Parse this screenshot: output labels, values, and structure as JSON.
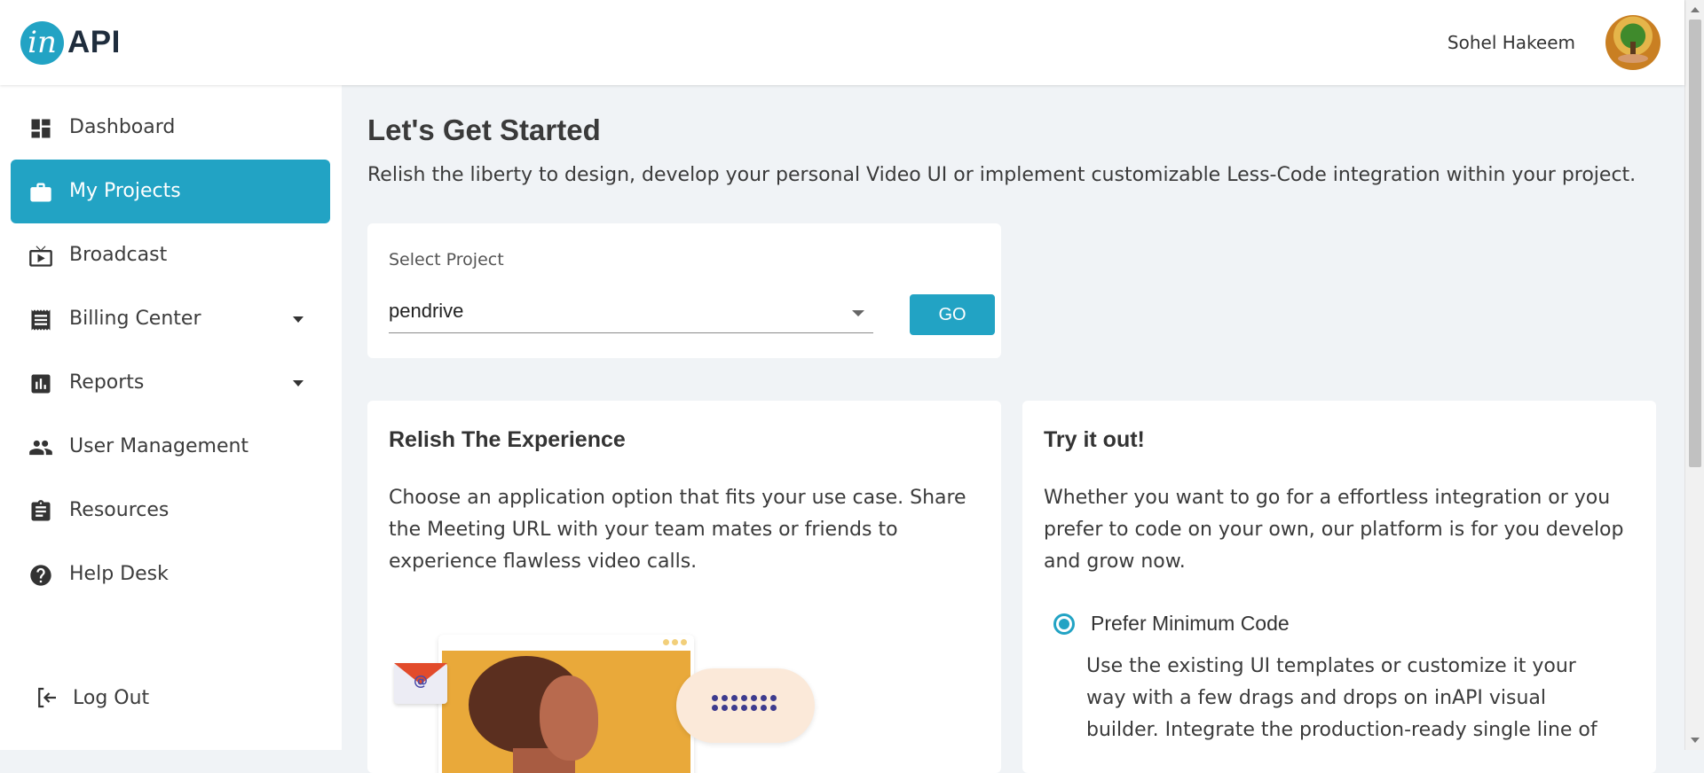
{
  "header": {
    "logo_letter": "in",
    "logo_text": "API",
    "user_name": "Sohel Hakeem"
  },
  "sidebar": {
    "items": [
      {
        "label": "Dashboard",
        "icon": "dashboard-icon"
      },
      {
        "label": "My Projects",
        "icon": "briefcase-icon",
        "active": true
      },
      {
        "label": "Broadcast",
        "icon": "tv-icon"
      },
      {
        "label": "Billing Center",
        "icon": "receipt-icon",
        "expandable": true
      },
      {
        "label": "Reports",
        "icon": "bar-chart-icon",
        "expandable": true
      },
      {
        "label": "User Management",
        "icon": "users-icon"
      },
      {
        "label": "Resources",
        "icon": "clipboard-icon"
      },
      {
        "label": "Help Desk",
        "icon": "help-icon"
      }
    ],
    "logout_label": "Log Out"
  },
  "main": {
    "title": "Let's Get Started",
    "subtitle": "Relish the liberty to design, develop your personal Video UI or implement customizable Less-Code integration within your project.",
    "select_project": {
      "label": "Select Project",
      "value": "pendrive",
      "go_label": "GO"
    },
    "experience_card": {
      "title": "Relish The Experience",
      "text": "Choose an application option that fits your use case. Share the Meeting URL with your team mates or friends to experience flawless video calls."
    },
    "try_card": {
      "title": "Try it out!",
      "text": "Whether you want to go for a effortless integration or you prefer to code on your own, our platform is for you develop and grow now.",
      "option_label": "Prefer Minimum Code",
      "option_desc": "Use the existing UI templates or customize it your way with a few drags and drops on inAPI visual builder. Integrate the production-ready single line of"
    }
  },
  "colors": {
    "accent": "#22a3c4",
    "background": "#f0f3f6"
  }
}
